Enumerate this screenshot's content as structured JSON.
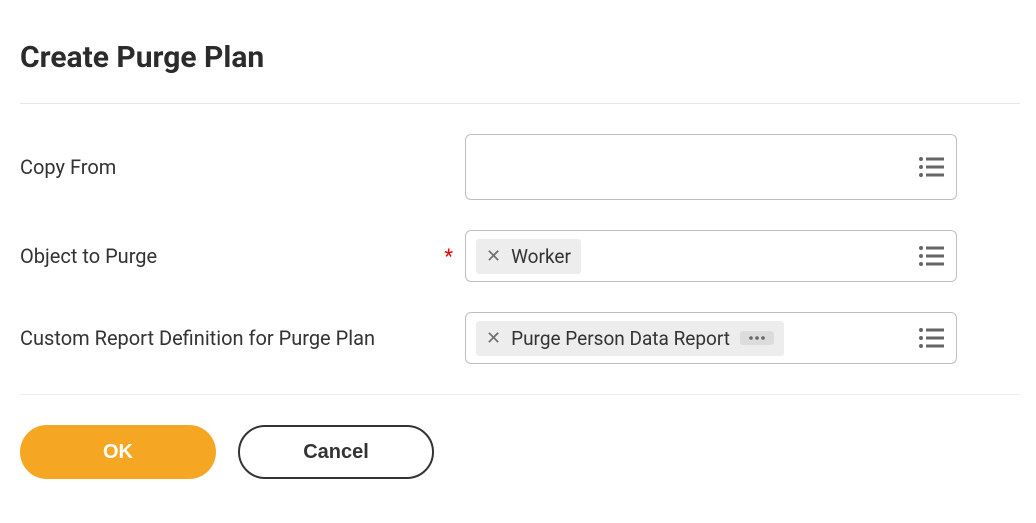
{
  "title": "Create Purge Plan",
  "fields": {
    "copyFrom": {
      "label": "Copy From",
      "required": false,
      "chips": []
    },
    "objectToPurge": {
      "label": "Object to Purge",
      "required": true,
      "chips": [
        {
          "label": "Worker",
          "hasMore": false
        }
      ]
    },
    "customReport": {
      "label": "Custom Report Definition for Purge Plan",
      "required": false,
      "chips": [
        {
          "label": "Purge Person Data Report",
          "hasMore": true
        }
      ]
    }
  },
  "buttons": {
    "ok": "OK",
    "cancel": "Cancel"
  }
}
